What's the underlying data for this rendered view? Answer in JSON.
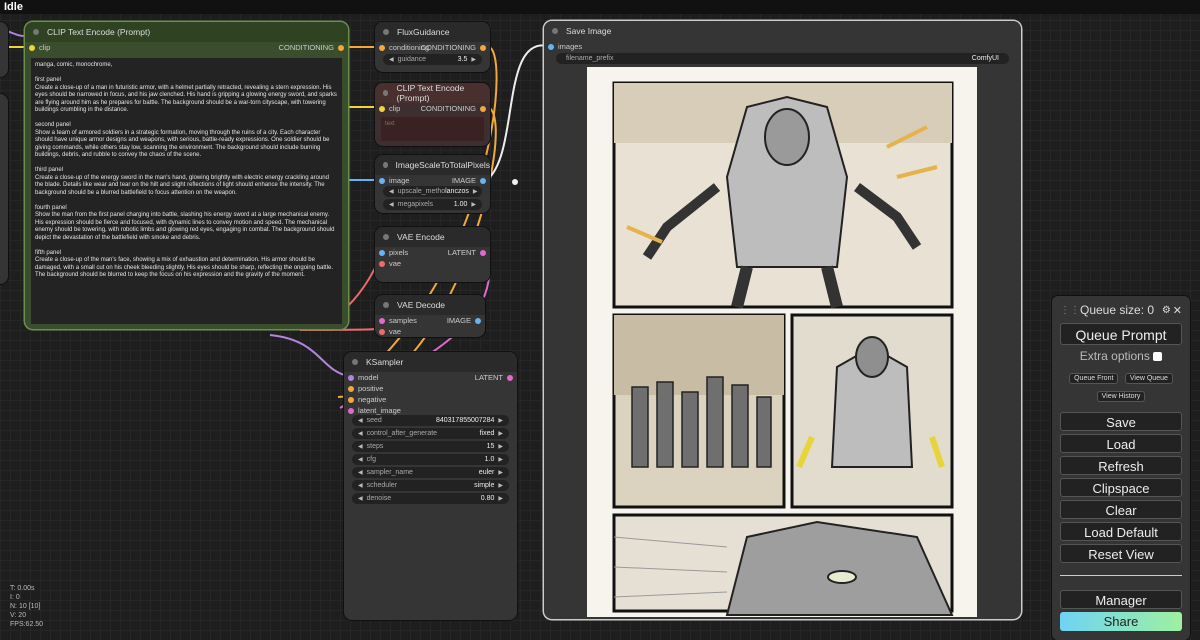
{
  "status": "Idle",
  "clip_node": {
    "title": "CLIP Text Encode (Prompt)",
    "input": "clip",
    "output": "CONDITIONING",
    "text": "manga, comic, monochrome,\n\nfirst panel\nCreate a close-up of a man in futuristic armor, with a helmet partially retracted, revealing a stern expression. His eyes should be narrowed in focus, and his jaw clenched. His hand is gripping a glowing energy sword, and sparks are flying around him as he prepares for battle. The background should be a war-torn cityscape, with towering buildings crumbling in the distance.\n\nsecond panel\nShow a team of armored soldiers in a strategic formation, moving through the ruins of a city. Each character should have unique armor designs and weapons, with serious, battle-ready expressions. One soldier should be giving commands, while others stay low, scanning the environment. The background should include burning buildings, debris, and rubble to convey the chaos of the scene.\n\nthird panel\nCreate a close-up of the energy sword in the man's hand, glowing brightly with electric energy crackling around the blade. Details like wear and tear on the hilt and slight reflections of light should enhance the intensity. The background should be a blurred battlefield to focus attention on the weapon.\n\nfourth panel\nShow the man from the first panel charging into battle, slashing his energy sword at a large mechanical enemy. His expression should be fierce and focused, with dynamic lines to convey motion and speed. The mechanical enemy should be towering, with robotic limbs and glowing red eyes, engaging in combat. The background should depict the devastation of the battlefield with smoke and debris.\n\nfifth panel\nCreate a close-up of the man's face, showing a mix of exhaustion and determination. His armor should be damaged, with a small cut on his cheek bleeding slightly. His eyes should be sharp, reflecting the ongoing battle. The background should be blurred to keep the focus on his expression and the gravity of the moment."
  },
  "flux_node": {
    "title": "FluxGuidance",
    "input": "conditioning",
    "output": "CONDITIONING",
    "widget_label": "guidance",
    "widget_value": "3.5"
  },
  "clip2_node": {
    "title": "CLIP Text Encode (Prompt)",
    "input": "clip",
    "output": "CONDITIONING",
    "placeholder": "text"
  },
  "scale_node": {
    "title": "ImageScaleToTotalPixels",
    "input": "image",
    "output": "IMAGE",
    "w1_label": "upscale_metho",
    "w1_value": "lanczos",
    "w2_label": "megapixels",
    "w2_value": "1.00"
  },
  "vae_encode": {
    "title": "VAE Encode",
    "in1": "pixels",
    "in2": "vae",
    "output": "LATENT"
  },
  "vae_decode": {
    "title": "VAE Decode",
    "in1": "samples",
    "in2": "vae",
    "output": "IMAGE"
  },
  "ksampler": {
    "title": "KSampler",
    "inputs": [
      "model",
      "positive",
      "negative",
      "latent_image"
    ],
    "output": "LATENT",
    "widgets": [
      {
        "label": "seed",
        "value": "840317855007284"
      },
      {
        "label": "control_after_generate",
        "value": "fixed"
      },
      {
        "label": "steps",
        "value": "15"
      },
      {
        "label": "cfg",
        "value": "1.0"
      },
      {
        "label": "sampler_name",
        "value": "euler"
      },
      {
        "label": "scheduler",
        "value": "simple"
      },
      {
        "label": "denoise",
        "value": "0.80"
      }
    ]
  },
  "save_node": {
    "title": "Save Image",
    "input": "images",
    "prefix_label": "filename_prefix",
    "prefix_value": "ComfyUI"
  },
  "panel": {
    "queue_size": "Queue size: 0",
    "queue_prompt": "Queue Prompt",
    "extra_options": "Extra options",
    "queue_front": "Queue Front",
    "view_queue": "View Queue",
    "view_history": "View History",
    "buttons": [
      "Save",
      "Load",
      "Refresh",
      "Clipspace",
      "Clear",
      "Load Default",
      "Reset View"
    ],
    "manager": "Manager",
    "share": "Share"
  },
  "stats": [
    "T: 0.00s",
    "I: 0",
    "N: 10 [10]",
    "V: 20",
    "FPS:62.50"
  ]
}
